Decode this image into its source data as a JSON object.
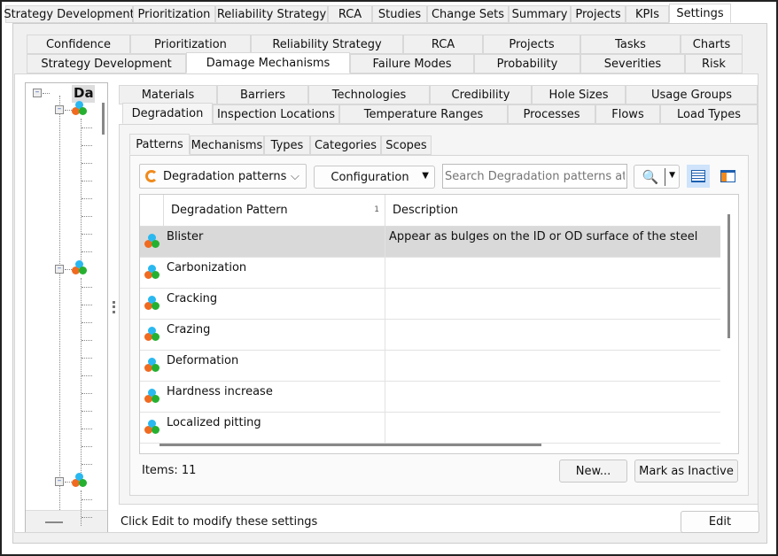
{
  "top_tabs": [
    "Strategy Development",
    "Prioritization",
    "Reliability Strategy",
    "RCA",
    "Studies",
    "Change Sets",
    "Summary",
    "Projects",
    "KPIs",
    "Settings"
  ],
  "settings_tabs_row1": [
    "Confidence",
    "Prioritization",
    "Reliability Strategy",
    "RCA",
    "Projects",
    "Tasks",
    "Charts"
  ],
  "settings_tabs_row2": [
    "Strategy Development",
    "Damage Mechanisms",
    "Failure Modes",
    "Probability",
    "Severities",
    "Risk"
  ],
  "dm_tabs_row1": [
    "Materials",
    "Barriers",
    "Technologies",
    "Credibility",
    "Hole Sizes",
    "Usage Groups"
  ],
  "dm_tabs_row2": [
    "Degradation",
    "Inspection Locations",
    "Temperature Ranges",
    "Processes",
    "Flows",
    "Load Types"
  ],
  "sub_tabs": [
    "Patterns",
    "Mechanisms",
    "Types",
    "Categories",
    "Scopes"
  ],
  "tree": {
    "root_label": "Da"
  },
  "toolbar": {
    "view_select": "Degradation patterns a",
    "configuration": "Configuration",
    "search_placeholder": "Search Degradation patterns at yo"
  },
  "grid": {
    "columns": [
      "Degradation Pattern",
      "Description"
    ],
    "sort_indicator": "1",
    "rows": [
      {
        "name": "Blister",
        "description": "Appear as bulges on the ID or OD surface of the steel"
      },
      {
        "name": "Carbonization",
        "description": ""
      },
      {
        "name": "Cracking",
        "description": ""
      },
      {
        "name": "Crazing",
        "description": ""
      },
      {
        "name": "Deformation",
        "description": ""
      },
      {
        "name": "Hardness increase",
        "description": ""
      },
      {
        "name": "Localized pitting",
        "description": ""
      }
    ]
  },
  "footer": {
    "items": "Items: 11",
    "new": "New...",
    "inactive": "Mark as Inactive",
    "hint": "Click Edit to modify these settings",
    "edit": "Edit"
  }
}
